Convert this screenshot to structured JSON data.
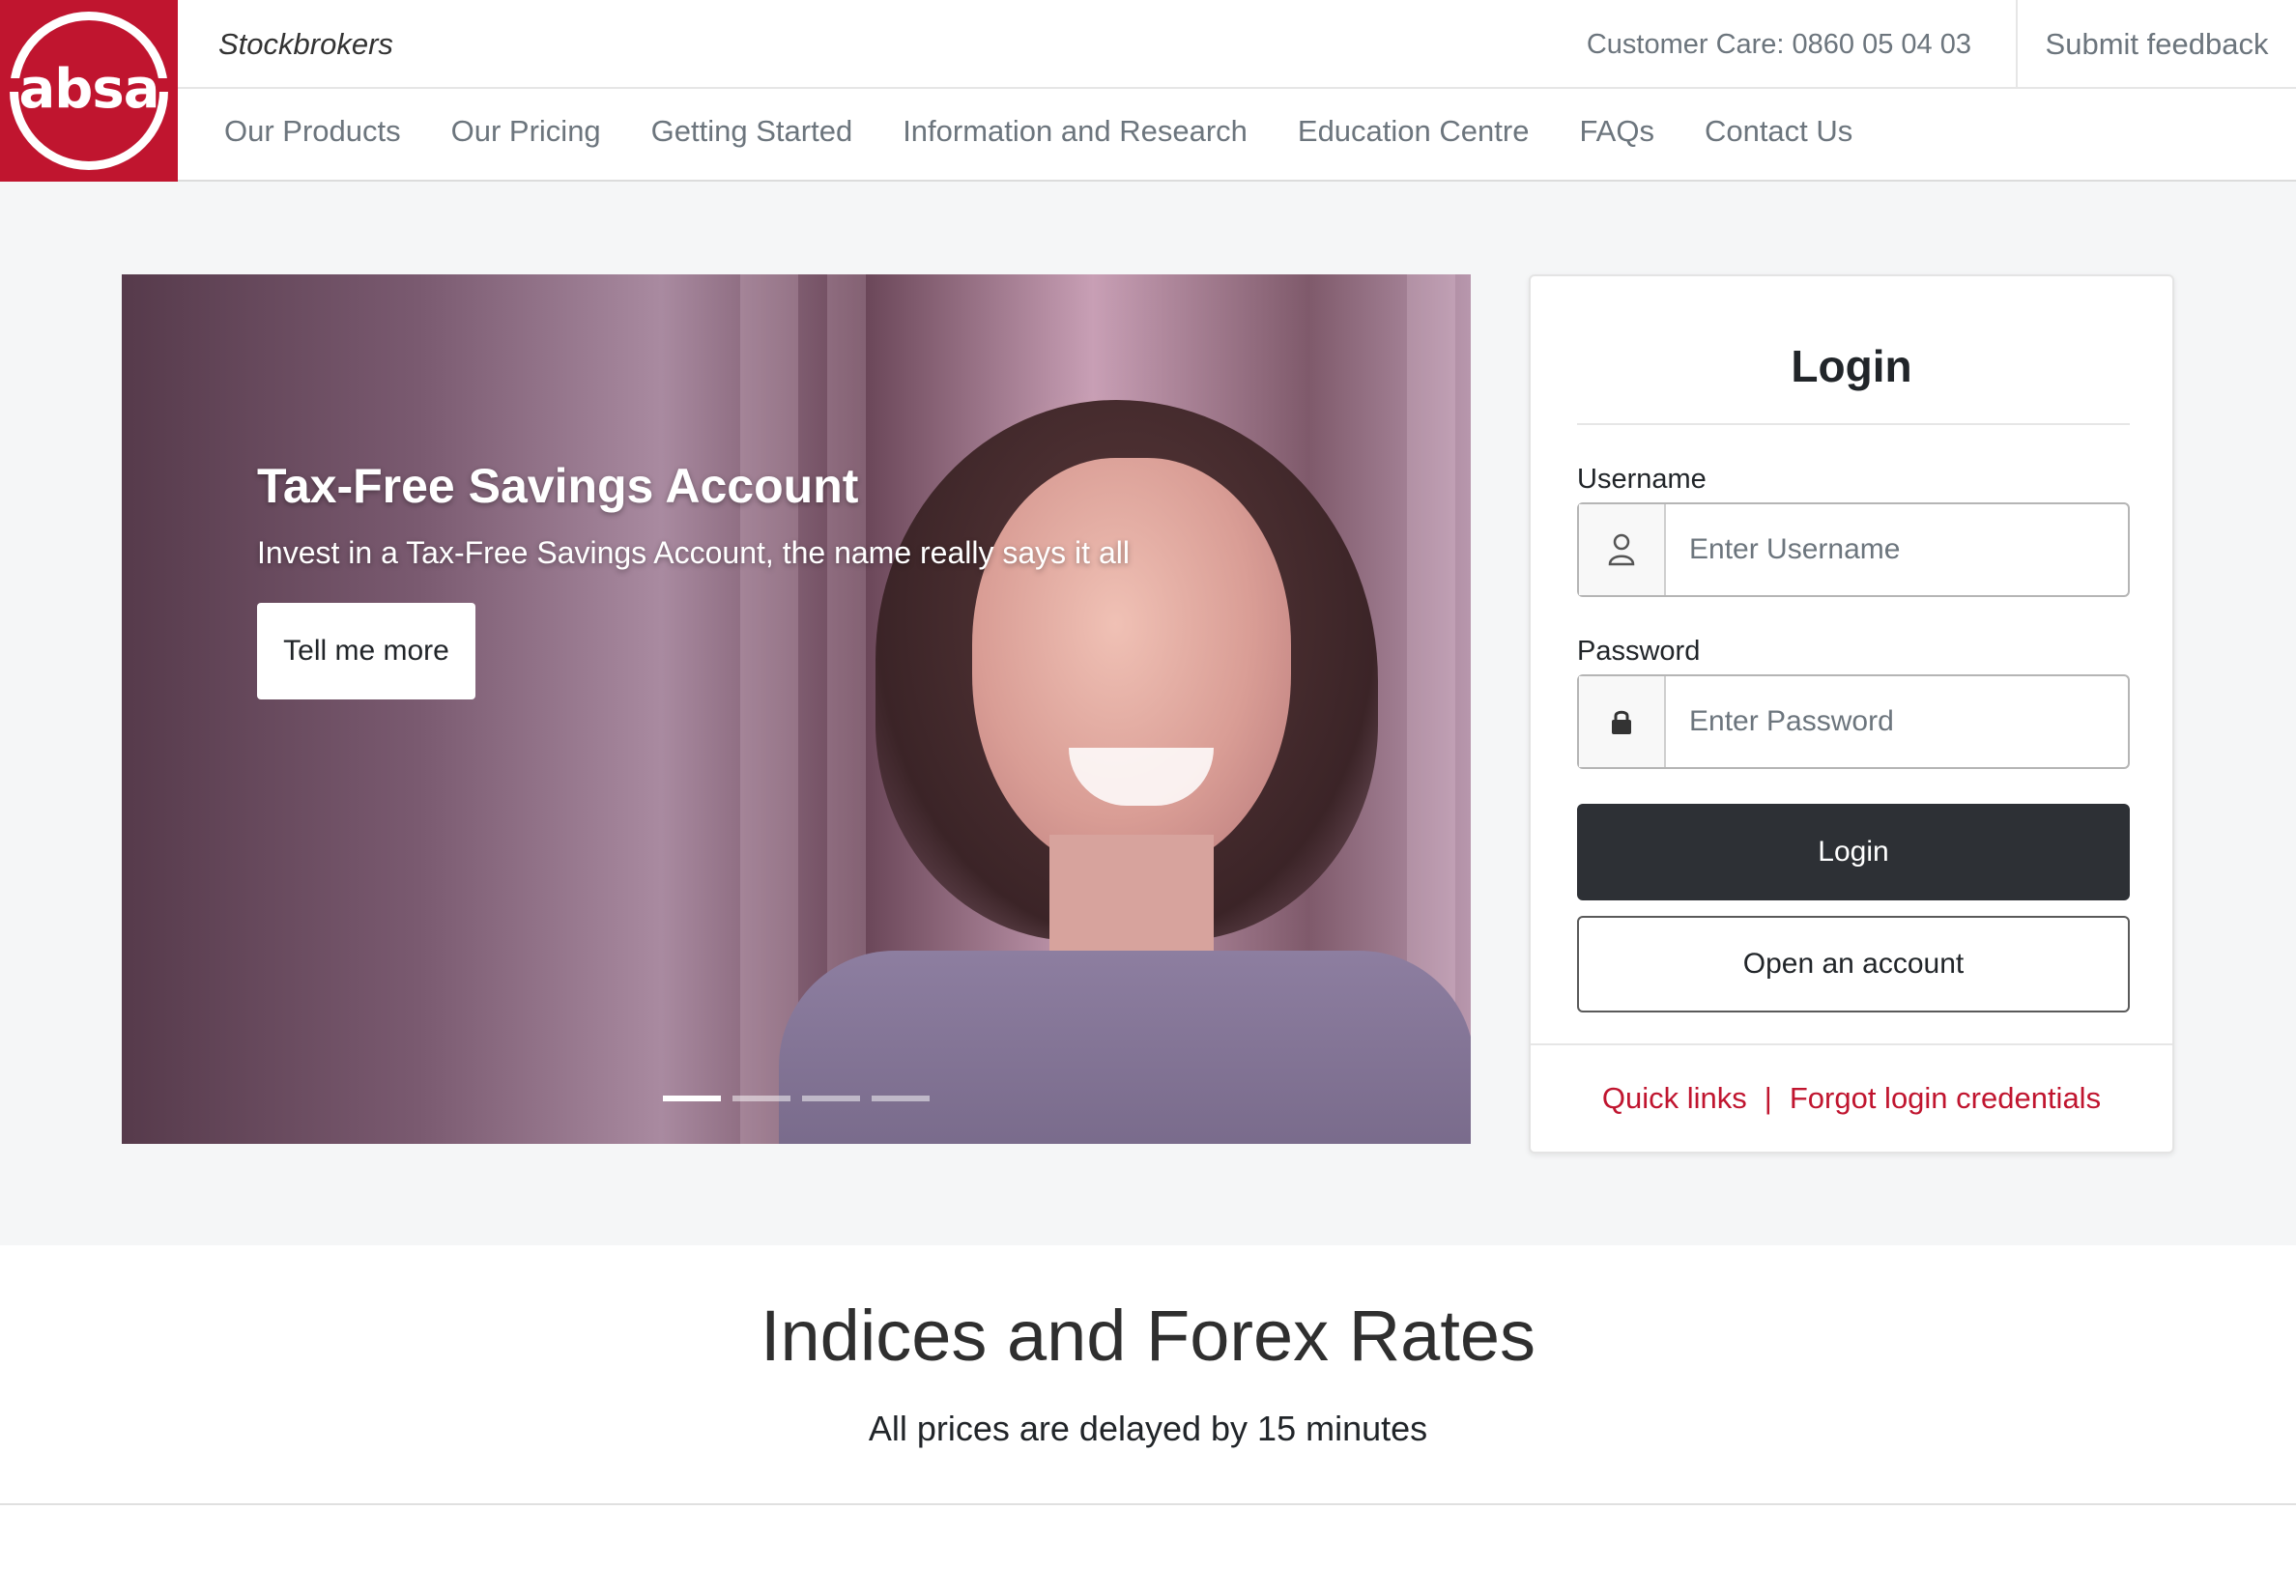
{
  "brand": {
    "logo_text": "absa",
    "sub_label": "Stockbrokers",
    "primary_color": "#c0152f"
  },
  "topbar": {
    "customer_care": "Customer Care: 0860 05 04 03",
    "feedback": "Submit feedback"
  },
  "nav": {
    "items": [
      {
        "label": "Our Products"
      },
      {
        "label": "Our Pricing"
      },
      {
        "label": "Getting Started"
      },
      {
        "label": "Information and Research"
      },
      {
        "label": "Education Centre"
      },
      {
        "label": "FAQs"
      },
      {
        "label": "Contact Us"
      }
    ]
  },
  "hero": {
    "title": "Tax-Free Savings Account",
    "subtitle": "Invest in a Tax-Free Savings Account, the name really says it all",
    "button": "Tell me more",
    "slide_count": 4,
    "active_slide": 1
  },
  "login": {
    "title": "Login",
    "username_label": "Username",
    "username_placeholder": "Enter Username",
    "password_label": "Password",
    "password_placeholder": "Enter Password",
    "login_button": "Login",
    "open_account_button": "Open an account",
    "quick_links": "Quick links",
    "separator": "|",
    "forgot": "Forgot login credentials",
    "icons": {
      "username": "user-icon",
      "password": "lock-icon"
    }
  },
  "indices": {
    "title": "Indices and Forex Rates",
    "subtitle": "All prices are delayed by 15 minutes"
  }
}
